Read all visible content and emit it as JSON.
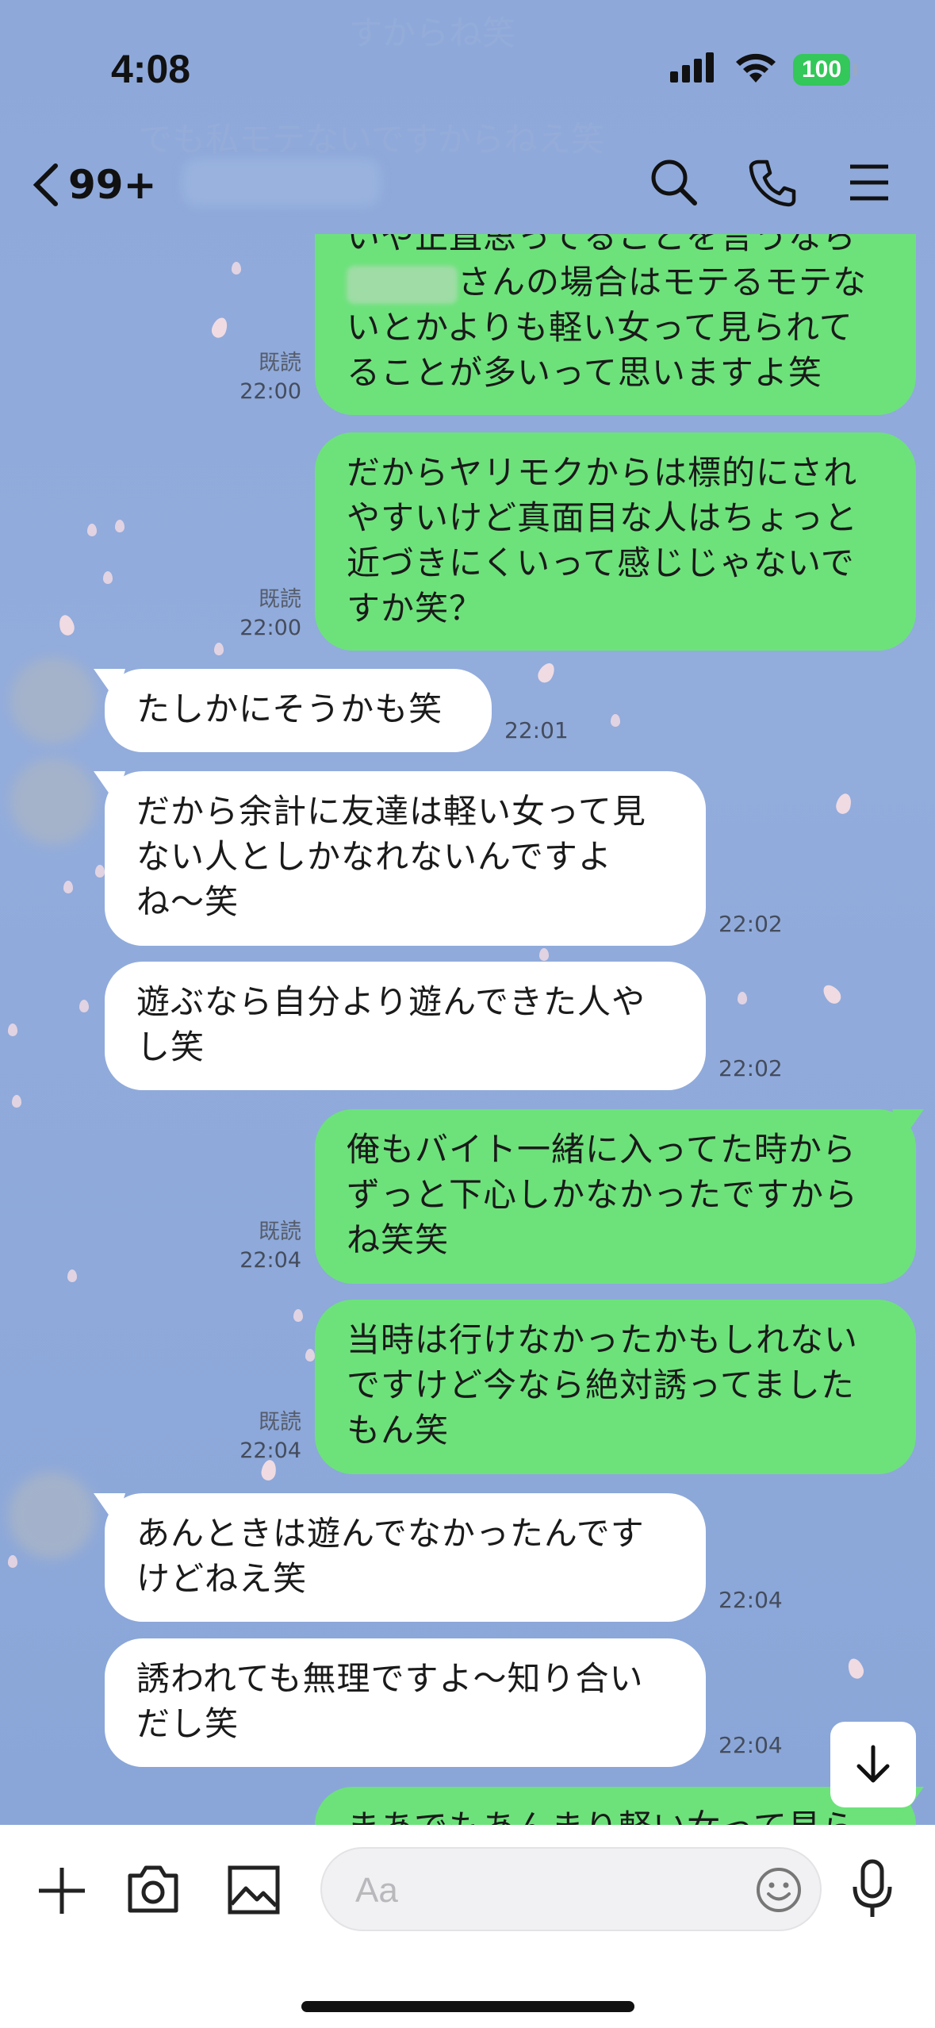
{
  "status_bar": {
    "time": "4:08",
    "battery": "100"
  },
  "ghost_messages": {
    "line1": "すからね笑",
    "line2": "でも私モテないですからねえ笑"
  },
  "header": {
    "back_count": "99+"
  },
  "messages": [
    {
      "dir": "out",
      "text": "いや正直思ってることを言うなら　　　さんの場合はモテるモテないとかよりも軽い女って見られてることが多いって思いますよ笑",
      "read": "既読",
      "time": "22:00"
    },
    {
      "dir": "out",
      "text": "だからヤリモクからは標的にされやすいけど真面目な人はちょっと近づきにくいって感じじゃないですか笑？",
      "read": "既読",
      "time": "22:00"
    },
    {
      "dir": "in",
      "text": "たしかにそうかも笑",
      "time": "22:01"
    },
    {
      "dir": "in",
      "text": "だから余計に友達は軽い女って見ない人としかなれないんですよね〜笑",
      "time": "22:02"
    },
    {
      "dir": "in",
      "text": "遊ぶなら自分より遊んできた人やし笑",
      "time": "22:02"
    },
    {
      "dir": "out",
      "text": "俺もバイト一緒に入ってた時からずっと下心しかなかったですからね笑笑",
      "read": "既読",
      "time": "22:04"
    },
    {
      "dir": "out",
      "text": "当時は行けなかったかもしれないですけど今なら絶対誘ってましたもん笑",
      "read": "既読",
      "time": "22:04"
    },
    {
      "dir": "in",
      "text": "あんときは遊んでなかったんですけどねえ笑",
      "time": "22:04"
    },
    {
      "dir": "in",
      "text": "誘われても無理ですよ〜知り合いだし笑",
      "time": "22:04"
    },
    {
      "dir": "out",
      "text": "まあでもあんまり軽い女って見ら",
      "time": ""
    }
  ],
  "m0": {
    "l1": "いや正直思ってることを言うなら",
    "l2a": "さんの場合はモテるモテな",
    "l3": "いとかよりも軽い女って見られて",
    "l4": "ることが多いって思いますよ笑"
  },
  "m1": {
    "l1": "だからヤリモクからは標的にされ",
    "l2": "やすいけど真面目な人はちょっと",
    "l3": "近づきにくいって感じじゃないで",
    "l4": "すか笑？"
  },
  "m3": {
    "l1": "だから余計に友達は軽い女って見",
    "l2": "ない人としかなれないんですよ",
    "l3": "ね〜笑"
  },
  "m4": {
    "l1": "遊ぶなら自分より遊んできた人や",
    "l2": "し笑"
  },
  "m5": {
    "l1": "俺もバイト一緒に入ってた時から",
    "l2": "ずっと下心しかなかったですから",
    "l3": "ね笑笑"
  },
  "m6": {
    "l1": "当時は行けなかったかもしれない",
    "l2": "ですけど今なら絶対誘ってました",
    "l3": "もん笑"
  },
  "m7": {
    "l1": "あんときは遊んでなかったんです",
    "l2": "けどねえ笑"
  },
  "m8": {
    "l1": "誘われても無理ですよ〜知り合い",
    "l2": "だし笑"
  },
  "input": {
    "placeholder": "Aa"
  },
  "colors": {
    "outgoing": "#6de27b",
    "incoming": "#ffffff",
    "background": "#8fa9d9",
    "battery": "#34c759"
  },
  "icons": [
    "back-chevron-icon",
    "search-icon",
    "phone-icon",
    "menu-icon",
    "plus-icon",
    "camera-icon",
    "image-icon",
    "emoji-icon",
    "mic-icon",
    "arrow-down-icon"
  ]
}
